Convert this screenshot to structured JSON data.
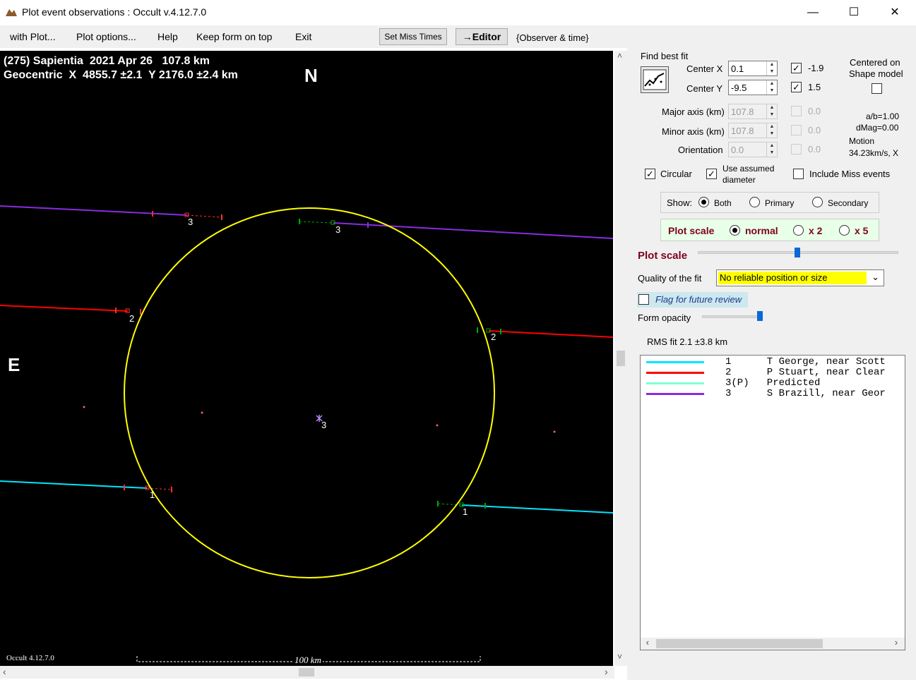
{
  "window": {
    "title": "Plot event observations : Occult v.4.12.7.0",
    "minimize": "—",
    "maximize": "☐",
    "close": "✕"
  },
  "menu": {
    "items": [
      "with Plot...",
      "Plot options...",
      "Help",
      "Keep form on top",
      "Exit"
    ],
    "set_miss_times": "Set Miss Times",
    "editor": "→Editor",
    "observer_time": "{Observer & time}"
  },
  "plot": {
    "header_line1": "(275) Sapientia  2021 Apr 26   107.8 km",
    "header_line2": "Geocentric  X  4855.7 ±2.1  Y 2176.0 ±2.4 km",
    "north_label": "N",
    "east_label": "E",
    "version_label": "Occult 4.12.7.0",
    "scale_label": "100 km",
    "chord_labels": [
      "3",
      "3",
      "2",
      "2",
      "1",
      "1",
      "3"
    ],
    "colors": {
      "background": "#000000",
      "ellipse": "#ffff00",
      "chord1": "#00e5ff",
      "chord2": "#ff0000",
      "chord3": "#8a2be2",
      "obs_green": "#00aa00",
      "obs_red": "#ff3030"
    }
  },
  "panel": {
    "find_best_fit": "Find best fit",
    "center_x_label": "Center X",
    "center_x_value": "0.1",
    "center_x_check": "-1.9",
    "center_y_label": "Center Y",
    "center_y_value": "-9.5",
    "center_y_check": "1.5",
    "centered_on": "Centered on",
    "shape_model": "Shape model",
    "major_axis_label": "Major axis (km)",
    "major_axis_value": "107.8",
    "major_axis_check": "0.0",
    "minor_axis_label": "Minor axis (km)",
    "minor_axis_value": "107.8",
    "minor_axis_check": "0.0",
    "orientation_label": "Orientation",
    "orientation_value": "0.0",
    "orientation_check": "0.0",
    "ab_ratio": "a/b=1.00",
    "dmag": "dMag=0.00",
    "motion_label": "Motion",
    "motion_value": "34.23km/s, X",
    "circular": "Circular",
    "use_assumed_1": "Use assumed",
    "use_assumed_2": "diameter",
    "include_miss": "Include Miss events",
    "show_label": "Show:",
    "show_both": "Both",
    "show_primary": "Primary",
    "show_secondary": "Secondary",
    "plot_scale_label": "Plot scale",
    "scale_normal": "normal",
    "scale_x2": "x 2",
    "scale_x5": "x 5",
    "plot_scale_slider_label": "Plot scale",
    "quality_label": "Quality of the fit",
    "quality_value": "No reliable position or size",
    "flag_review": "Flag for future review",
    "form_opacity": "Form opacity",
    "rms_fit": "RMS fit 2.1 ±3.8 km"
  },
  "legend": [
    {
      "color": "#00e5ff",
      "text": "1      T George, near Scott"
    },
    {
      "color": "#ff0000",
      "text": "2      P Stuart, near Clear"
    },
    {
      "color": "#7fffd4",
      "text": "3(P)   Predicted"
    },
    {
      "color": "#8a2be2",
      "text": "3      S Brazill, near Geor"
    }
  ]
}
